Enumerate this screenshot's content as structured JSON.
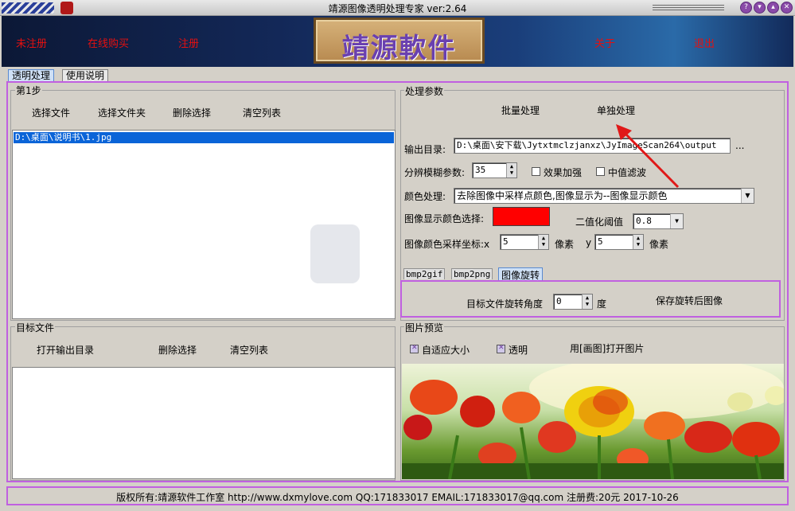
{
  "window": {
    "title": "靖源图像透明处理专家 ver:2.64"
  },
  "banner": {
    "links": [
      "未注册",
      "在线购买",
      "注册",
      "关于",
      "退出"
    ],
    "logo_text": "靖源軟件"
  },
  "tabs": [
    {
      "label": "透明处理",
      "active": true
    },
    {
      "label": "使用说明",
      "active": false
    }
  ],
  "step1": {
    "title": "第1步",
    "buttons": [
      "选择文件",
      "选择文件夹",
      "删除选择",
      "清空列表"
    ],
    "files": [
      "D:\\桌面\\说明书\\1.jpg"
    ]
  },
  "target": {
    "title": "目标文件",
    "buttons": [
      "打开输出目录",
      "删除选择",
      "清空列表"
    ]
  },
  "params": {
    "title": "处理参数",
    "mode_buttons": [
      "批量处理",
      "单独处理"
    ],
    "output_label": "输出目录:",
    "output_value": "D:\\桌面\\安下载\\Jytxtmclzjanxz\\JyImageScan264\\output",
    "browse_label": "...",
    "blur_label": "分辨模糊参数:",
    "blur_value": "35",
    "enhance_label": "效果加强",
    "median_label": "中值滤波",
    "color_label": "颜色处理:",
    "color_value": "去除图像中采样点颜色,图像显示为--图像显示颜色",
    "display_color_label": "图像显示颜色选择:",
    "display_color": "#ff0000",
    "threshold_label": "二值化阈值",
    "threshold_value": "0.8",
    "sample_label": "图像颜色采样坐标:x",
    "sample_x": "5",
    "pixel_unit": "像素",
    "y_label": "y",
    "sample_y": "5"
  },
  "subtabs": [
    {
      "label": "bmp2gif"
    },
    {
      "label": "bmp2png"
    },
    {
      "label": "图像旋转",
      "active": true
    }
  ],
  "rotate": {
    "angle_label": "目标文件旋转角度",
    "angle_value": "0",
    "unit": "度",
    "save_label": "保存旋转后图像"
  },
  "preview": {
    "title": "图片预览",
    "fit_label": "自适应大小",
    "fit_checked": true,
    "transparent_label": "透明",
    "transparent_checked": true,
    "open_paint_label": "用[画图]打开图片"
  },
  "footer": {
    "text": "版权所有:靖源软件工作室 http://www.dxmylove.com QQ:171833017 EMAIL:171833017@qq.com 注册费:20元 2017-10-26"
  },
  "colors": {
    "accent_border": "#c060e0",
    "banner_link": "#e41010",
    "selection": "#0a64d8"
  }
}
